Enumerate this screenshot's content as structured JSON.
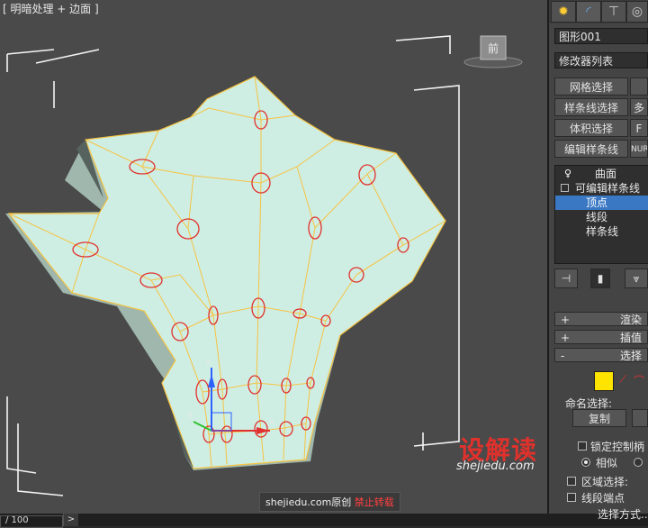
{
  "viewport": {
    "label": "[ 明暗处理 + 边面 ]",
    "viewcube_label": "前",
    "axis_x": "x",
    "axis_y": "y",
    "axis_z": "z",
    "watermark_logo": "设解读",
    "watermark_url": "shejiedu.com",
    "credit_text": "shejiedu.com原创",
    "credit_warning": "禁止转载",
    "mesh_color": "#d2efe5",
    "edge_color": "#f5c342",
    "marker_color": "#e1302c"
  },
  "status": {
    "frame_counter": "/ 100",
    "next_glyph": ">"
  },
  "panel": {
    "tabs": [
      "sun-icon",
      "curve-icon",
      "hierarchy-icon",
      "display-icon"
    ],
    "object_name": "图形001",
    "modifier_list": "修改器列表",
    "buttons": [
      {
        "label": "网格选择"
      },
      {
        "label": "样条线选择"
      },
      {
        "label": "多"
      },
      {
        "label": "体积选择"
      },
      {
        "label": "F"
      },
      {
        "label": "编辑样条线"
      },
      {
        "label": "NUR"
      }
    ],
    "stack": {
      "items": [
        {
          "label": "曲面"
        },
        {
          "label": "可编辑样条线"
        },
        {
          "label": "顶点"
        },
        {
          "label": "线段"
        },
        {
          "label": "样条线"
        }
      ]
    },
    "rollouts": [
      {
        "sign": "+",
        "label": "渲染"
      },
      {
        "sign": "+",
        "label": "插值"
      },
      {
        "sign": "-",
        "label": "选择"
      }
    ],
    "named_selection_label": "命名选择:",
    "copy_button": "复制",
    "lock_handles": "锁定控制柄",
    "similar": "相似",
    "area_selection": "区域选择:",
    "segment_end": "线段端点",
    "selection_method": "选择方式..."
  }
}
